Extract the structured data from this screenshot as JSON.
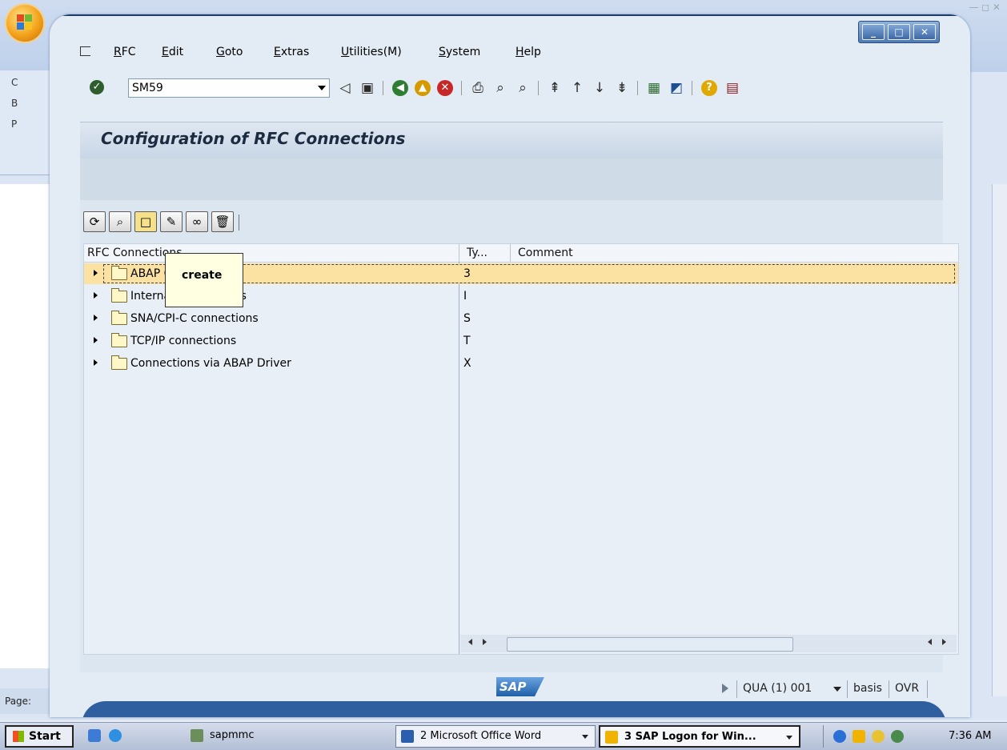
{
  "word": {
    "left_items": [
      "C",
      "B",
      "P"
    ],
    "status_label": "Page:"
  },
  "sap": {
    "menu": [
      "RFC",
      "Edit",
      "Goto",
      "Extras",
      "Utilities(M)",
      "System",
      "Help"
    ],
    "command_field": "SM59",
    "page_title": "Configuration of RFC Connections",
    "tree": {
      "columns": [
        "RFC Connections",
        "Ty...",
        "Comment"
      ],
      "rows": [
        {
          "label": "ABAP Connections",
          "visible_label": "ABAP Connections",
          "type": "3"
        },
        {
          "label": "Internal Connections",
          "type": "I"
        },
        {
          "label": "SNA/CPI-C connections",
          "type": "S"
        },
        {
          "label": "TCP/IP connections",
          "type": "T"
        },
        {
          "label": "Connections via ABAP Driver",
          "type": "X"
        }
      ]
    },
    "tooltip": "create",
    "status": {
      "system": "QUA (1) 001",
      "user": "basis",
      "mode": "OVR",
      "logo": "SAP"
    }
  },
  "taskbar": {
    "start": "Start",
    "tasks": [
      "sapmmc",
      "2 Microsoft Office Word",
      "3 SAP Logon for Win..."
    ],
    "clock": "7:36 AM"
  }
}
